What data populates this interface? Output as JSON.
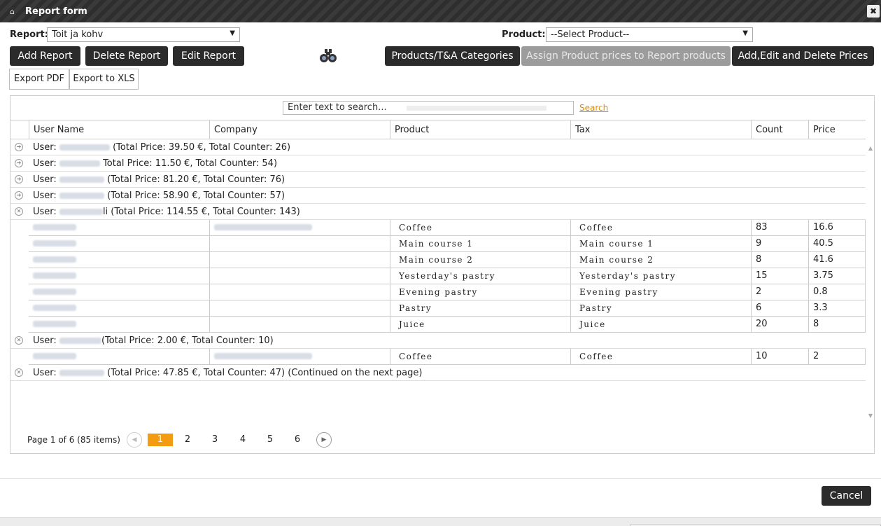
{
  "window": {
    "title": "Report form",
    "close_glyph": "✖"
  },
  "report": {
    "label": "Report:",
    "value": "Toit ja kohv"
  },
  "product": {
    "label": "Product:",
    "value": "--Select Product--"
  },
  "buttons": {
    "add_report": "Add Report",
    "delete_report": "Delete Report",
    "edit_report": "Edit Report",
    "categories": "Products/T&A Categories",
    "assign_prices": "Assign Product prices to Report products",
    "manage_prices": "Add,Edit and Delete Prices",
    "export_pdf": "Export PDF",
    "export_xls": "Export to XLS",
    "cancel": "Cancel"
  },
  "search": {
    "placeholder": "Enter text to search...",
    "link": "Search"
  },
  "columns": [
    "User Name",
    "Company",
    "Product",
    "Tax",
    "Count",
    "Price"
  ],
  "groups": [
    {
      "prefix": "User:",
      "suffix": "(Total Price: 39.50 €, Total Counter: 26)"
    },
    {
      "prefix": "User:",
      "suffix": "Total Price: 11.50 €, Total Counter: 54)"
    },
    {
      "prefix": "User:",
      "suffix": "(Total Price: 81.20 €, Total Counter: 76)"
    },
    {
      "prefix": "User:",
      "suffix": "(Total Price: 58.90 €, Total Counter: 57)"
    },
    {
      "prefix": "User:",
      "suffix": "li (Total Price: 114.55 €, Total Counter: 143)"
    },
    {
      "prefix": "User:",
      "suffix": "(Total Price: 2.00 €, Total Counter: 10)"
    },
    {
      "prefix": "User:",
      "suffix": "(Total Price: 47.85 €, Total Counter: 47) (Continued on the next page)"
    }
  ],
  "rows_group5": [
    {
      "product": "Coffee",
      "tax": "Coffee",
      "count": "83",
      "price": "16.6"
    },
    {
      "product": "Main course 1",
      "tax": "Main course 1",
      "count": "9",
      "price": "40.5"
    },
    {
      "product": "Main course 2",
      "tax": "Main course 2",
      "count": "8",
      "price": "41.6"
    },
    {
      "product": "Yesterday's pastry",
      "tax": "Yesterday's pastry",
      "count": "15",
      "price": "3.75"
    },
    {
      "product": "Evening pastry",
      "tax": "Evening pastry",
      "count": "2",
      "price": "0.8"
    },
    {
      "product": "Pastry",
      "tax": "Pastry",
      "count": "6",
      "price": "3.3"
    },
    {
      "product": "Juice",
      "tax": "Juice",
      "count": "20",
      "price": "8"
    }
  ],
  "rows_group6": [
    {
      "product": "Coffee",
      "tax": "Coffee",
      "count": "10",
      "price": "2"
    }
  ],
  "pager": {
    "info": "Page 1 of 6 (85 items)",
    "pages": [
      "1",
      "2",
      "3",
      "4",
      "5",
      "6"
    ],
    "prev": "◀",
    "next": "▶"
  }
}
